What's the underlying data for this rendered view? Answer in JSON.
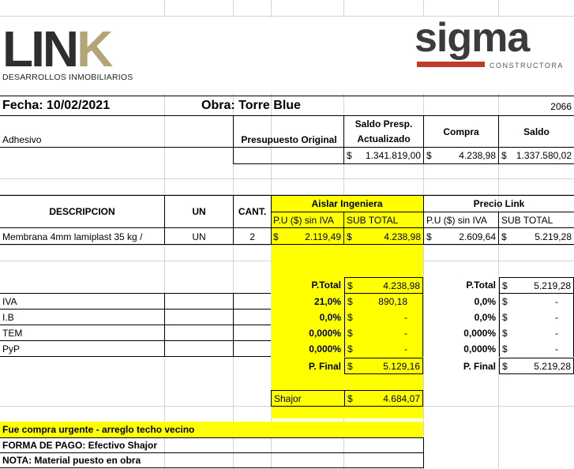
{
  "logos": {
    "link_word": "LINK",
    "link_sub": "DESARROLLOS INMOBILIARIOS",
    "sigma_word": "sigma",
    "sigma_sub": "CONSTRUCTORA",
    "accent_gold": "#b5a476",
    "accent_red": "#c0392b"
  },
  "header": {
    "fecha": "Fecha: 10/02/2021",
    "obra": "Obra: Torre Blue",
    "number": "2066"
  },
  "summary": {
    "label": "Adhesivo",
    "presupuesto_header": "Presupuesto Original",
    "saldo_presp_header_1": "Saldo Presp.",
    "saldo_presp_header_2": "Actualizado",
    "compra_header": "Compra",
    "saldo_header": "Saldo",
    "cur": "$",
    "saldo_presp_value": "1.341.819,00",
    "compra_value": "4.238,98",
    "saldo_value": "1.337.580,02"
  },
  "table": {
    "col_desc": "DESCRIPCION",
    "col_un": "UN",
    "col_cant": "CANT.",
    "group_aislar": "Aislar Ingeniera",
    "group_link": "Precio Link",
    "pu_label": "P.U ($) sin IVA",
    "subtotal_label": "SUB TOTAL",
    "item": {
      "desc": "Membrana 4mm lamiplast 35 kg /",
      "un": "UN",
      "cant": "2",
      "a_pu": "2.119,49",
      "a_sub": "4.238,98",
      "l_pu": "2.609,64",
      "l_sub": "5.219,28"
    }
  },
  "totals": {
    "ptotal_label": "P.Total",
    "a_ptotal": "4.238,98",
    "l_ptotal": "5.219,28",
    "rows": [
      {
        "label": "IVA",
        "a_pct": "21,0%",
        "a_val": "890,18",
        "l_pct": "0,0%",
        "l_val": "-"
      },
      {
        "label": "I.B",
        "a_pct": "0,0%",
        "a_val": "-",
        "l_pct": "0,0%",
        "l_val": "-"
      },
      {
        "label": "TEM",
        "a_pct": "0,000%",
        "a_val": "-",
        "l_pct": "0,000%",
        "l_val": "-"
      },
      {
        "label": "PyP",
        "a_pct": "0,000%",
        "a_val": "-",
        "l_pct": "0,000%",
        "l_val": "-"
      }
    ],
    "pfinal_label": "P. Final",
    "a_pfinal": "5.129,16",
    "l_pfinal": "5.219,28",
    "shajor_label": "Shajor",
    "shajor_value": "4.684,07"
  },
  "notes": {
    "urgent": "Fue compra urgente - arreglo techo vecino",
    "forma_pago": "FORMA DE PAGO: Efectivo  Shajor",
    "nota": "NOTA:  Material puesto en obra"
  }
}
